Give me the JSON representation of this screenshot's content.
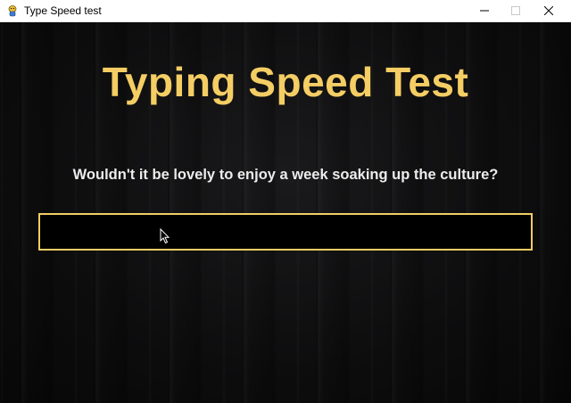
{
  "window": {
    "title": "Type Speed test",
    "controls": {
      "minimize_icon": "minimize-icon",
      "maximize_icon": "maximize-icon",
      "close_icon": "close-icon"
    },
    "app_icon": "pygame-snake-icon"
  },
  "game": {
    "heading": "Typing Speed Test",
    "sentence": "Wouldn't it be lovely to enjoy a week soaking up the culture?",
    "input_value": "",
    "colors": {
      "accent": "#f4cd64",
      "text": "#ececec",
      "background": "#0c0c0d",
      "input_background": "#000000"
    }
  }
}
